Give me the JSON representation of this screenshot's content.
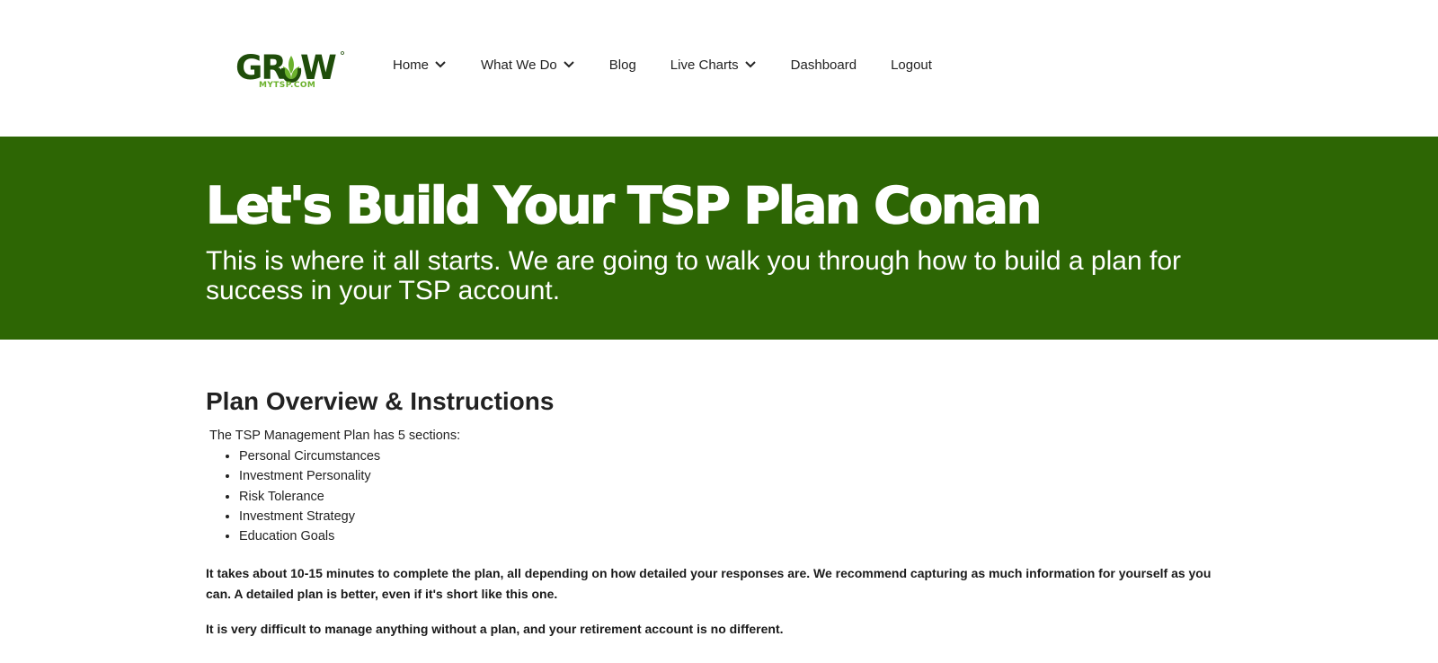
{
  "brand": {
    "logo_word_left": "GR",
    "logo_word_right": "W",
    "logo_tagline": "MYTSP.COM",
    "primary_color": "#2d6604",
    "logo_light_green": "#6bb12c",
    "logo_dark_green": "#1f4d0a"
  },
  "nav": {
    "items": [
      {
        "label": "Home",
        "has_dropdown": true
      },
      {
        "label": "What We Do",
        "has_dropdown": true
      },
      {
        "label": "Blog",
        "has_dropdown": false
      },
      {
        "label": "Live Charts",
        "has_dropdown": true
      },
      {
        "label": "Dashboard",
        "has_dropdown": false
      },
      {
        "label": "Logout",
        "has_dropdown": false
      }
    ]
  },
  "hero": {
    "title": "Let's Build Your TSP Plan Conan",
    "subtitle": "This is where it all starts. We are going to walk you through how to build a plan for success in your TSP account."
  },
  "main": {
    "section_title": "Plan Overview & Instructions",
    "intro": "The TSP Management Plan has 5 sections:",
    "sections": [
      "Personal Circumstances",
      "Investment Personality",
      "Risk Tolerance",
      "Investment Strategy",
      "Education Goals"
    ],
    "paragraph_1": "It takes about 10-15 minutes to complete the plan, all depending on how detailed your responses are. We recommend capturing as much information for yourself as you can. A detailed plan is better, even if it's short like this one.",
    "paragraph_2": "It is very difficult to manage anything without a plan, and your retirement account is no different."
  }
}
